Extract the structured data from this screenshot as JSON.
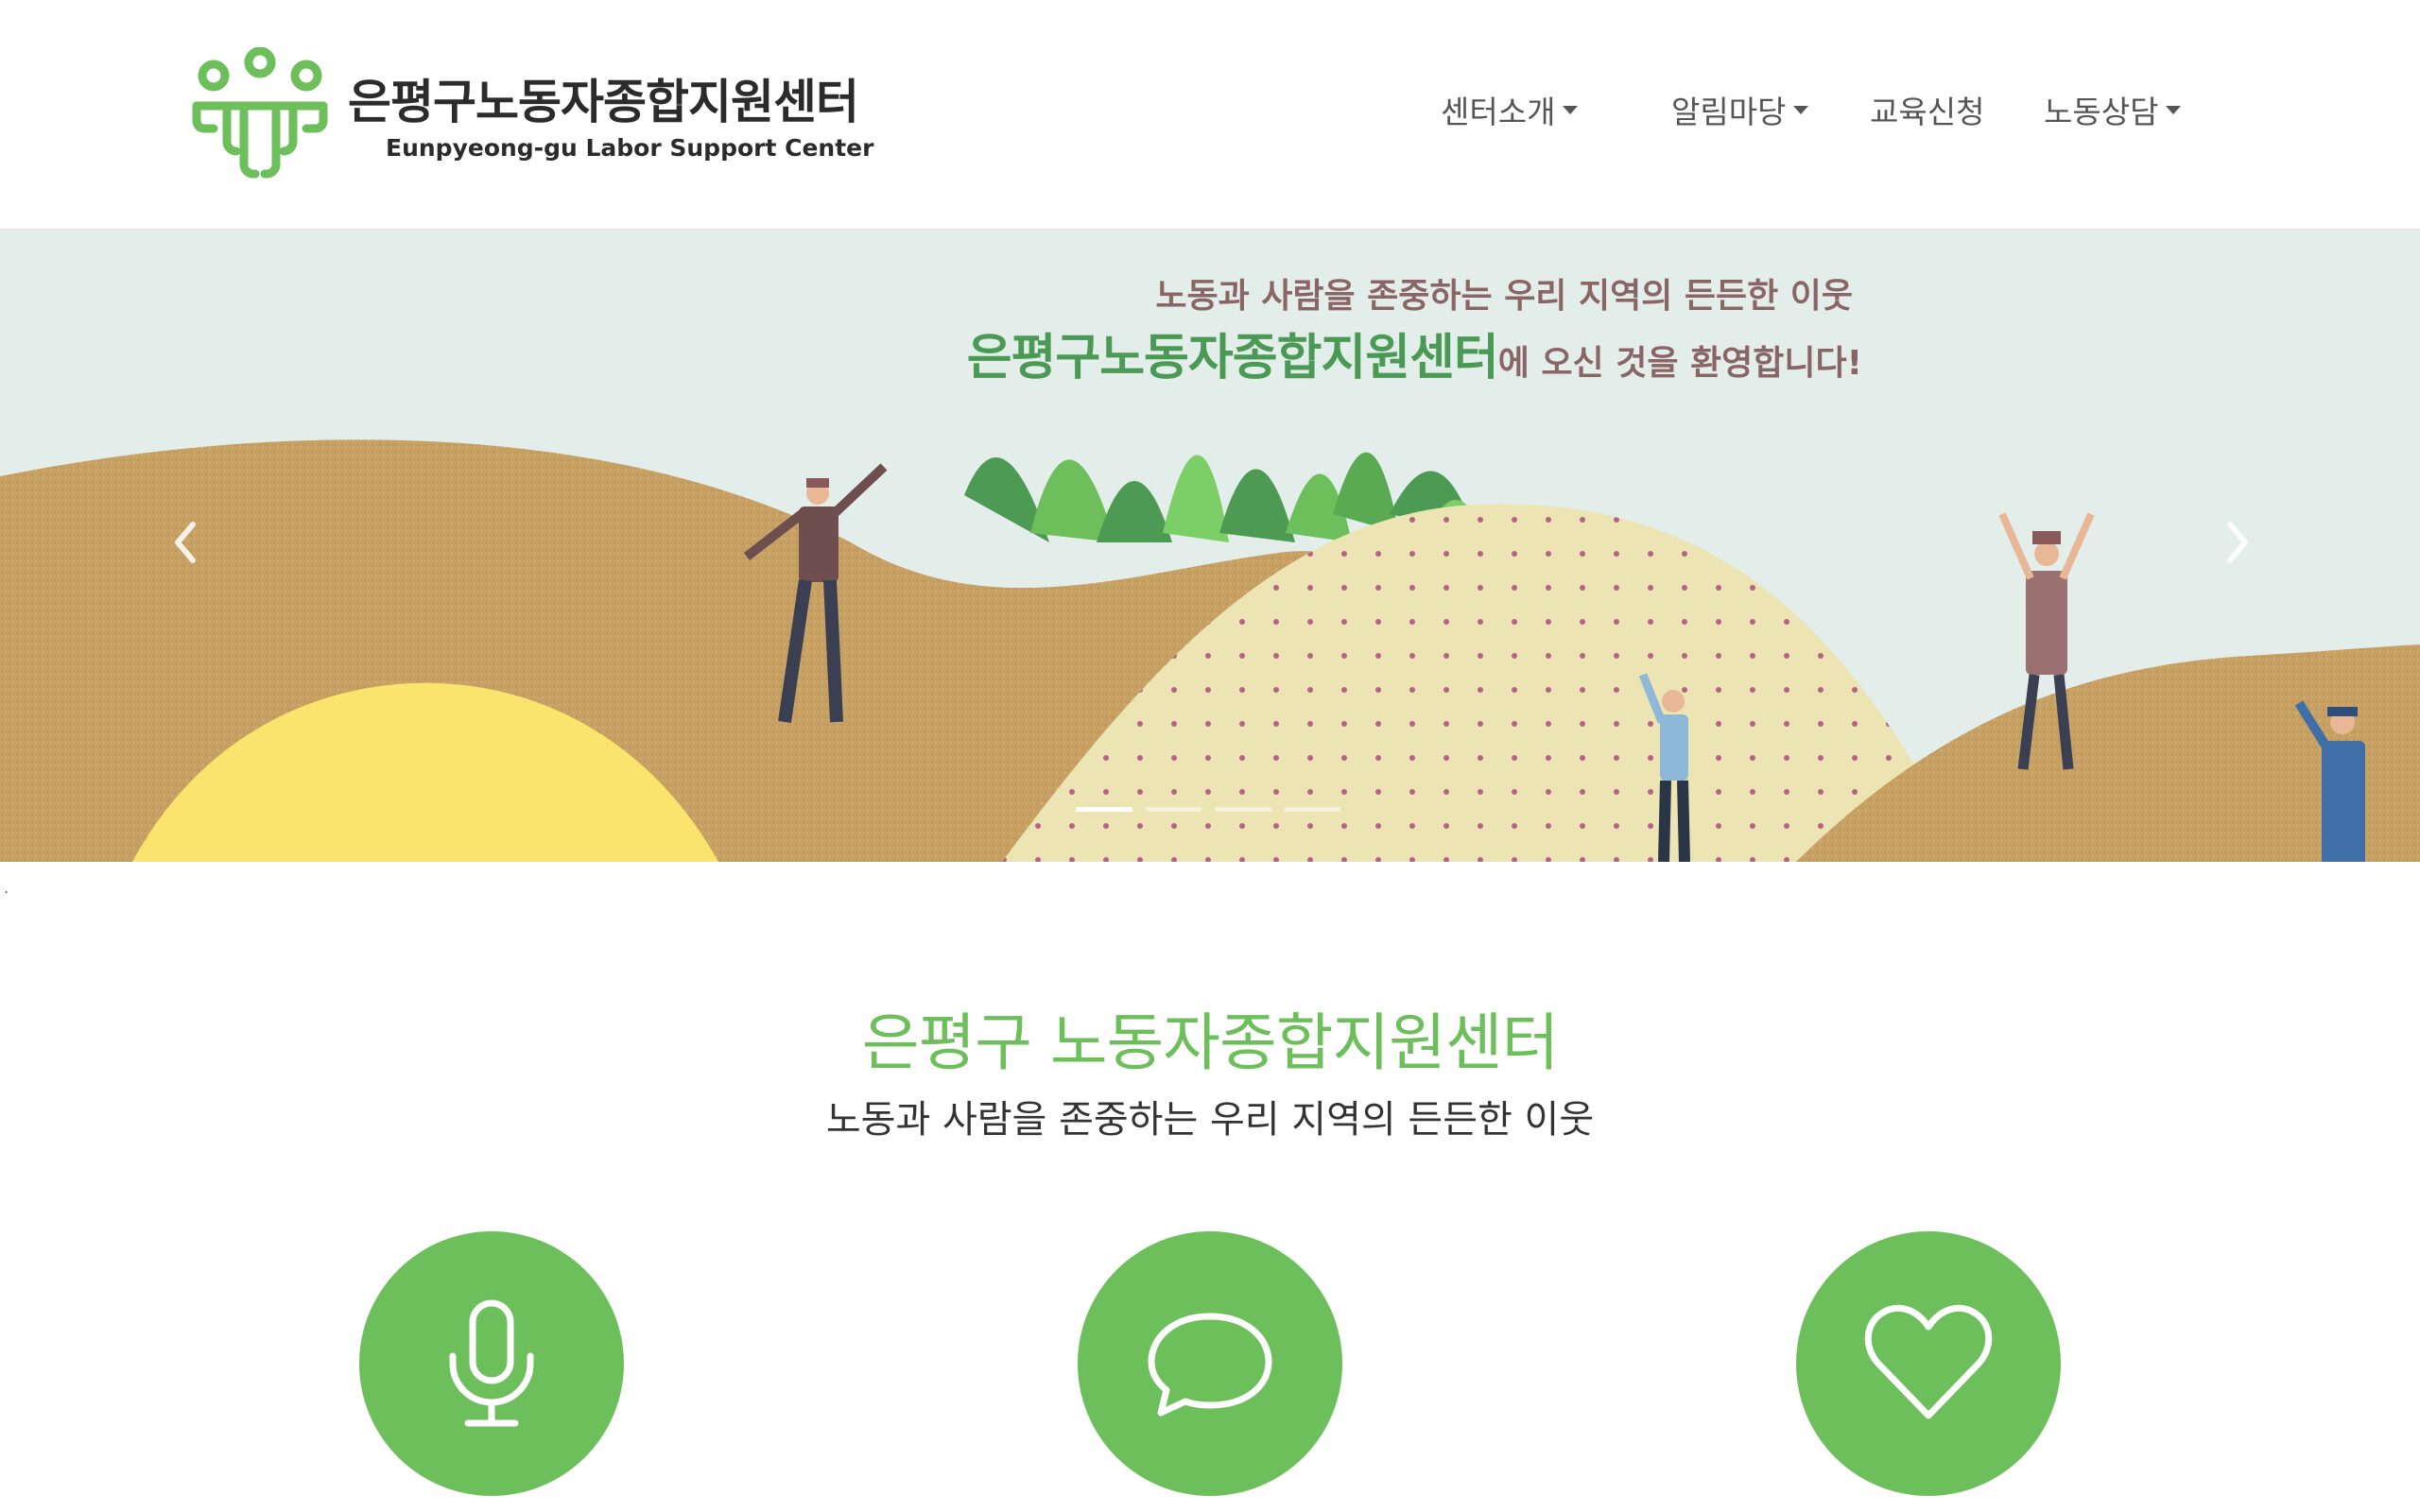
{
  "header": {
    "logo_ko": "은평구노동자종합지원센터",
    "logo_en": "Eunpyeong-gu Labor Support Center",
    "nav": [
      {
        "label": "센터소개",
        "dropdown": true
      },
      {
        "label": "알림마당",
        "dropdown": true
      },
      {
        "label": "교육신청",
        "dropdown": false
      },
      {
        "label": "노동상담",
        "dropdown": true
      }
    ]
  },
  "carousel": {
    "line1": "노동과 사람을 존중하는 우리 지역의 든든한 이웃",
    "line2_accent": "은평구노동자종합지원센터",
    "line2_rest": "에 오신 것을 환영합니다!",
    "slide_count": 4,
    "active_slide": 1,
    "prev_icon": "chevron-left-icon",
    "next_icon": "chevron-right-icon"
  },
  "stray_mark": ".",
  "intro": {
    "title": "은평구 노동자종합지원센터",
    "subtitle": "노동과 사람을 존중하는 우리 지역의 든든한 이웃",
    "features": [
      {
        "icon": "microphone-icon"
      },
      {
        "icon": "speech-bubble-icon"
      },
      {
        "icon": "heart-icon"
      }
    ]
  },
  "colors": {
    "brand_green": "#6cbf5a",
    "hero_text": "#8a6565",
    "hero_accent": "#4a9a55",
    "sky": "#e3eeeb",
    "sand": "#c8a163",
    "yellow_hill": "#fbe46d",
    "dotted_hill": "#ece4b2"
  }
}
